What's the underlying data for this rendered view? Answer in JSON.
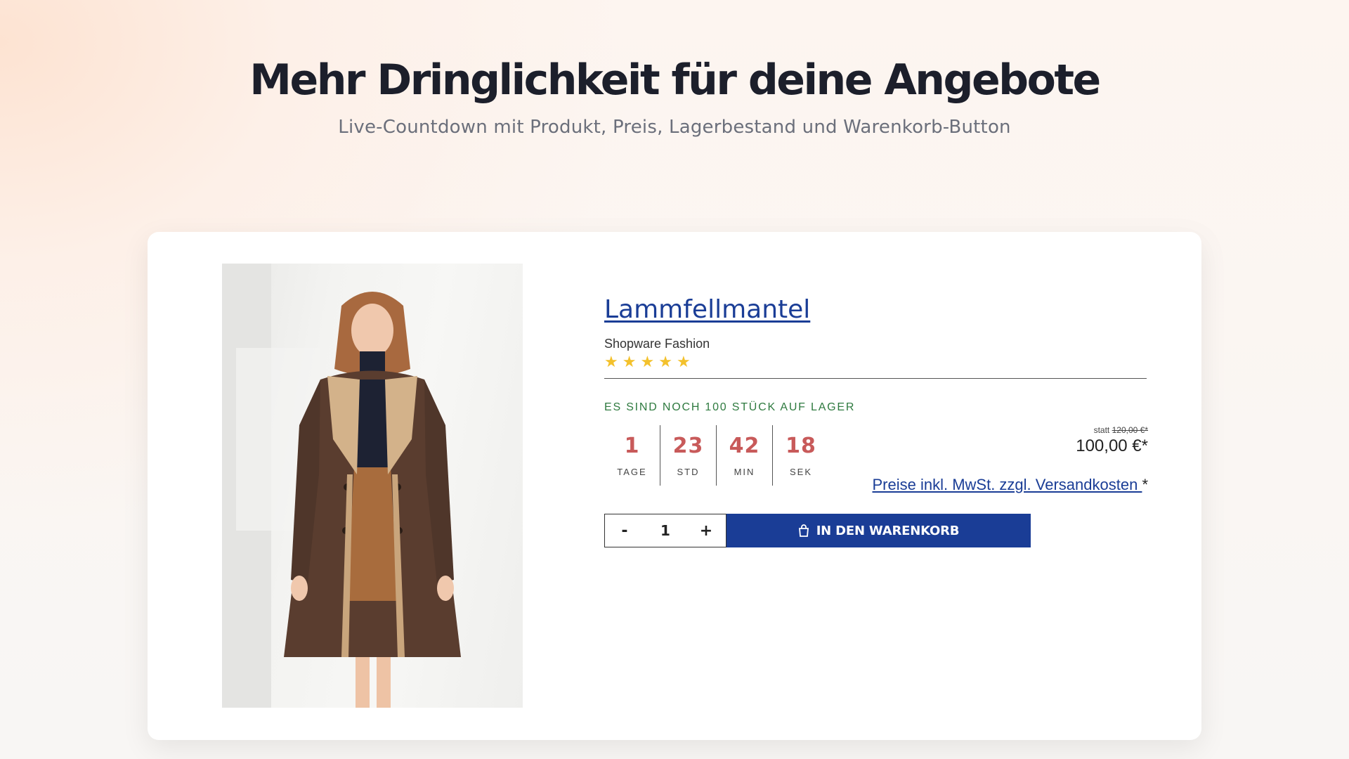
{
  "hero": {
    "title": "Mehr Dringlichkeit für deine Angebote",
    "subtitle": "Live-Countdown mit Produkt, Preis, Lagerbestand und Warenkorb-Button"
  },
  "product": {
    "image_alt": "Frau im braunen Lammfellmantel",
    "title": "Lammfellmantel",
    "manufacturer": "Shopware Fashion",
    "rating_stars": 5,
    "stock_text": "ES SIND NOCH 100 STÜCK AUF LAGER",
    "countdown": [
      {
        "value": "1",
        "label": "TAGE"
      },
      {
        "value": "23",
        "label": "STD"
      },
      {
        "value": "42",
        "label": "MIN"
      },
      {
        "value": "18",
        "label": "SEK"
      }
    ],
    "old_price_prefix": "statt",
    "old_price": "120,00 €*",
    "new_price": "100,00 €*",
    "tax_link": "Preise inkl. MwSt. zzgl. Versandkosten ",
    "tax_suffix": "*",
    "quantity": {
      "minus": "-",
      "value": "1",
      "plus": "+"
    },
    "cart_button": "IN DEN WARENKORB"
  },
  "colors": {
    "accent": "#1a3d96",
    "countdown": "#c85a5a",
    "stock": "#2e7a3f",
    "star": "#f3c12c"
  }
}
